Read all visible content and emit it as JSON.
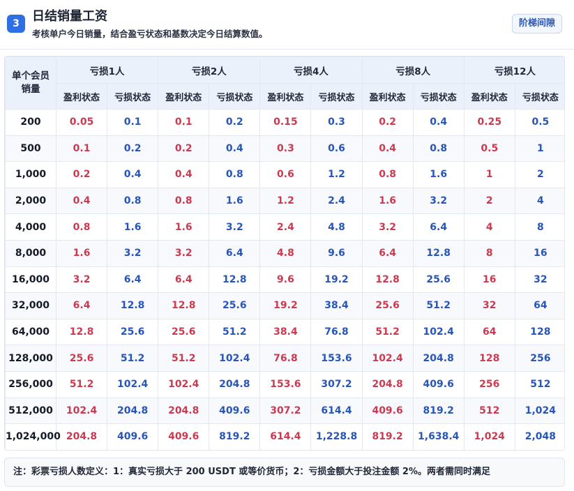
{
  "header": {
    "step": "3",
    "title": "日结销量工资",
    "subtitle": "考核单户今日销量，结合盈亏状态和基数决定今日结算数值。",
    "tier_button": "阶梯间隙"
  },
  "table": {
    "member_header": "单个会员\n销量",
    "groups": [
      "亏损1人",
      "亏损2人",
      "亏损4人",
      "亏损8人",
      "亏损12人"
    ],
    "sub_headers": [
      "盈利状态",
      "亏损状态"
    ],
    "rows": [
      {
        "sales": "200",
        "values": [
          "0.05",
          "0.1",
          "0.1",
          "0.2",
          "0.15",
          "0.3",
          "0.2",
          "0.4",
          "0.25",
          "0.5"
        ]
      },
      {
        "sales": "500",
        "values": [
          "0.1",
          "0.2",
          "0.2",
          "0.4",
          "0.3",
          "0.6",
          "0.4",
          "0.8",
          "0.5",
          "1"
        ]
      },
      {
        "sales": "1,000",
        "values": [
          "0.2",
          "0.4",
          "0.4",
          "0.8",
          "0.6",
          "1.2",
          "0.8",
          "1.6",
          "1",
          "2"
        ]
      },
      {
        "sales": "2,000",
        "values": [
          "0.4",
          "0.8",
          "0.8",
          "1.6",
          "1.2",
          "2.4",
          "1.6",
          "3.2",
          "2",
          "4"
        ]
      },
      {
        "sales": "4,000",
        "values": [
          "0.8",
          "1.6",
          "1.6",
          "3.2",
          "2.4",
          "4.8",
          "3.2",
          "6.4",
          "4",
          "8"
        ]
      },
      {
        "sales": "8,000",
        "values": [
          "1.6",
          "3.2",
          "3.2",
          "6.4",
          "4.8",
          "9.6",
          "6.4",
          "12.8",
          "8",
          "16"
        ]
      },
      {
        "sales": "16,000",
        "values": [
          "3.2",
          "6.4",
          "6.4",
          "12.8",
          "9.6",
          "19.2",
          "12.8",
          "25.6",
          "16",
          "32"
        ]
      },
      {
        "sales": "32,000",
        "values": [
          "6.4",
          "12.8",
          "12.8",
          "25.6",
          "19.2",
          "38.4",
          "25.6",
          "51.2",
          "32",
          "64"
        ]
      },
      {
        "sales": "64,000",
        "values": [
          "12.8",
          "25.6",
          "25.6",
          "51.2",
          "38.4",
          "76.8",
          "51.2",
          "102.4",
          "64",
          "128"
        ]
      },
      {
        "sales": "128,000",
        "values": [
          "25.6",
          "51.2",
          "51.2",
          "102.4",
          "76.8",
          "153.6",
          "102.4",
          "204.8",
          "128",
          "256"
        ]
      },
      {
        "sales": "256,000",
        "values": [
          "51.2",
          "102.4",
          "102.4",
          "204.8",
          "153.6",
          "307.2",
          "204.8",
          "409.6",
          "256",
          "512"
        ]
      },
      {
        "sales": "512,000",
        "values": [
          "102.4",
          "204.8",
          "204.8",
          "409.6",
          "307.2",
          "614.4",
          "409.6",
          "819.2",
          "512",
          "1,024"
        ]
      },
      {
        "sales": "1,024,000",
        "values": [
          "204.8",
          "409.6",
          "409.6",
          "819.2",
          "614.4",
          "1,228.8",
          "819.2",
          "1,638.4",
          "1,024",
          "2,048"
        ]
      }
    ]
  },
  "note": "注：彩票亏损人数定义：1：真实亏损大于 200 USDT 或等价货币；2：亏损金额大于投注金额 2%。两者需同时满足",
  "colors": {
    "accent": "#2f6fe4",
    "profit": "#cc3a4f",
    "loss": "#2755b8",
    "header_bg": "#eaf1fb"
  }
}
